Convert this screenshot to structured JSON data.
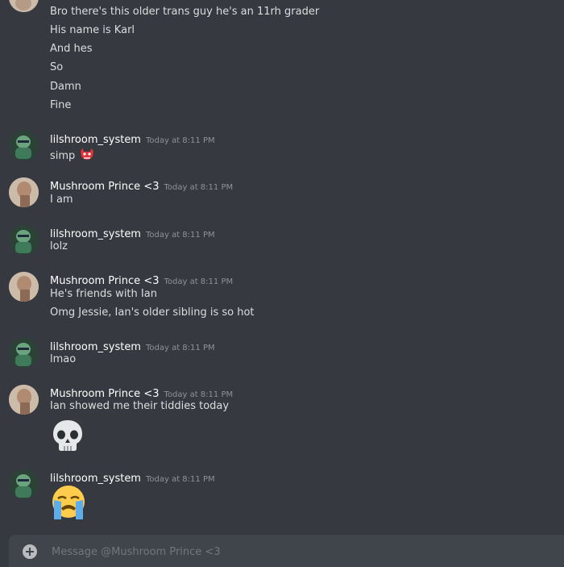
{
  "messages": [
    {
      "author": null,
      "timestamp": null,
      "lines": [
        "Bro there's this older trans guy he's an 11rh grader",
        "His name is Karl",
        "And hes",
        "So",
        "Damn",
        "Fine"
      ]
    },
    {
      "author": "lilshroom_system",
      "timestamp": "Today at 8:11 PM",
      "lines": [
        "simp"
      ],
      "inline_emoji": "goblin-mask-emoji"
    },
    {
      "author": "Mushroom Prince <3",
      "timestamp": "Today at 8:11 PM",
      "lines": [
        "I am"
      ]
    },
    {
      "author": "lilshroom_system",
      "timestamp": "Today at 8:11 PM",
      "lines": [
        "lolz"
      ]
    },
    {
      "author": "Mushroom Prince <3",
      "timestamp": "Today at 8:11 PM",
      "lines": [
        "He's friends with Ian",
        "Omg Jessie, Ian's older sibling is so hot"
      ]
    },
    {
      "author": "lilshroom_system",
      "timestamp": "Today at 8:11 PM",
      "lines": [
        "lmao"
      ]
    },
    {
      "author": "Mushroom Prince <3",
      "timestamp": "Today at 8:11 PM",
      "lines": [
        "Ian showed me their tiddies today"
      ],
      "big_emoji": "skull-emoji"
    },
    {
      "author": "lilshroom_system",
      "timestamp": "Today at 8:11 PM",
      "lines": [],
      "big_emoji": "loudly-crying-face-emoji"
    }
  ],
  "composer": {
    "placeholder": "Message @Mushroom Prince <3"
  },
  "colors": {
    "background": "#36393f",
    "username": "#ffffff",
    "timestamp": "#8e9297",
    "message_text": "#dcddde",
    "composer_bg": "#40444b"
  }
}
